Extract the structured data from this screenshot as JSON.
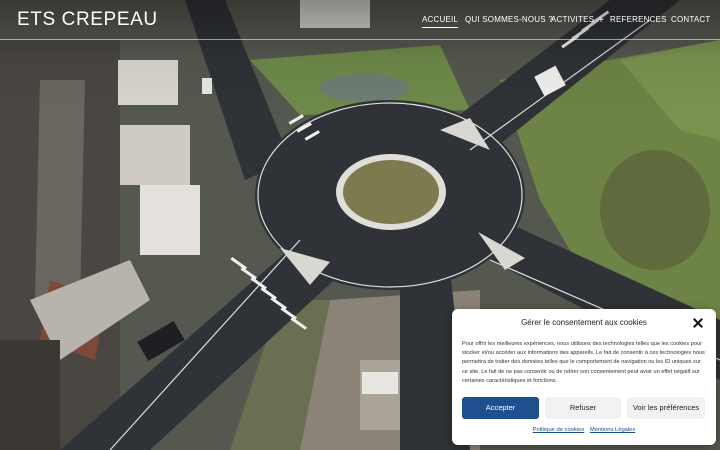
{
  "brand": {
    "logo_text": "ETS CREPEAU"
  },
  "nav": {
    "items": [
      {
        "label": "ACCUEIL",
        "active": true
      },
      {
        "label": "QUI SOMMES-NOUS ?",
        "active": false
      },
      {
        "label": "ACTIVITES",
        "active": false,
        "has_submenu": true
      },
      {
        "label": "REFERENCES",
        "active": false
      },
      {
        "label": "CONTACT",
        "active": false
      }
    ],
    "submenu_symbol": "+"
  },
  "cookie": {
    "title": "Gérer le consentement aux cookies",
    "body": "Pour offrir les meilleures expériences, nous utilisons des technologies telles que les cookies pour stocker et/ou accéder aux informations des appareils. Le fait de consentir à ces technologies nous permettra de traiter des données telles que le comportement de navigation ou les ID uniques sur ce site. Le fait de ne pas consentir ou de retirer son consentement peut avoir un effet négatif sur certaines caractéristiques et fonctions.",
    "accept_label": "Accepter",
    "refuse_label": "Refuser",
    "preferences_label": "Voir les préférences",
    "policy_link": "Politique de cookies",
    "legal_link": "Mentions Légales"
  },
  "colors": {
    "accent": "#1e4f8f",
    "asphalt": "#2f3236",
    "grass": "#6b7f45",
    "header_text": "#ffffff"
  },
  "icons": {
    "close": "close-icon",
    "submenu": "plus-icon"
  }
}
